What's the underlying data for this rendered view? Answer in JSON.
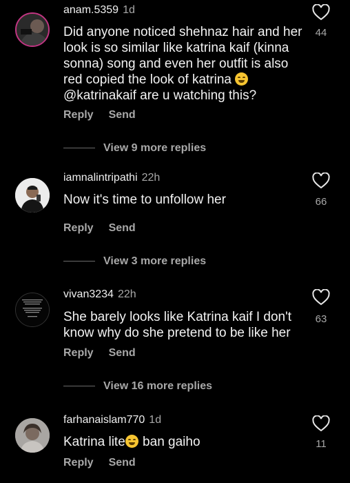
{
  "comments": [
    {
      "username": "anam.5359",
      "time": "1d",
      "text_before": "Did anyone noticed shehnaz hair and her look is so similar like katrina kaif (kinna sonna) song and even her outfit is also red copied the look of katrina ",
      "text_after": "@katrinakaif are u watching this?",
      "emoji": "laughing-emoji",
      "likes": "44",
      "reply_label": "Reply",
      "send_label": "Send",
      "view_replies": "View 9 more replies"
    },
    {
      "username": "iamnalintripathi",
      "time": "22h",
      "text": "Now it's time to unfollow her",
      "likes": "66",
      "reply_label": "Reply",
      "send_label": "Send",
      "view_replies": "View 3 more replies"
    },
    {
      "username": "vivan3234",
      "time": "22h",
      "text": "She barely looks like Katrina kaif I don't know why do she pretend to be like her",
      "likes": "63",
      "reply_label": "Reply",
      "send_label": "Send",
      "view_replies": "View 16 more replies"
    },
    {
      "username": "farhanaislam770",
      "time": "1d",
      "text_before": "Katrina lite",
      "text_after": " ban gaiho",
      "emoji": "smiling-emoji",
      "likes": "11",
      "reply_label": "Reply",
      "send_label": "Send"
    }
  ],
  "colors": {
    "background": "#000000",
    "secondary_text": "#a8a8a8",
    "story_ring": "#c13584"
  }
}
